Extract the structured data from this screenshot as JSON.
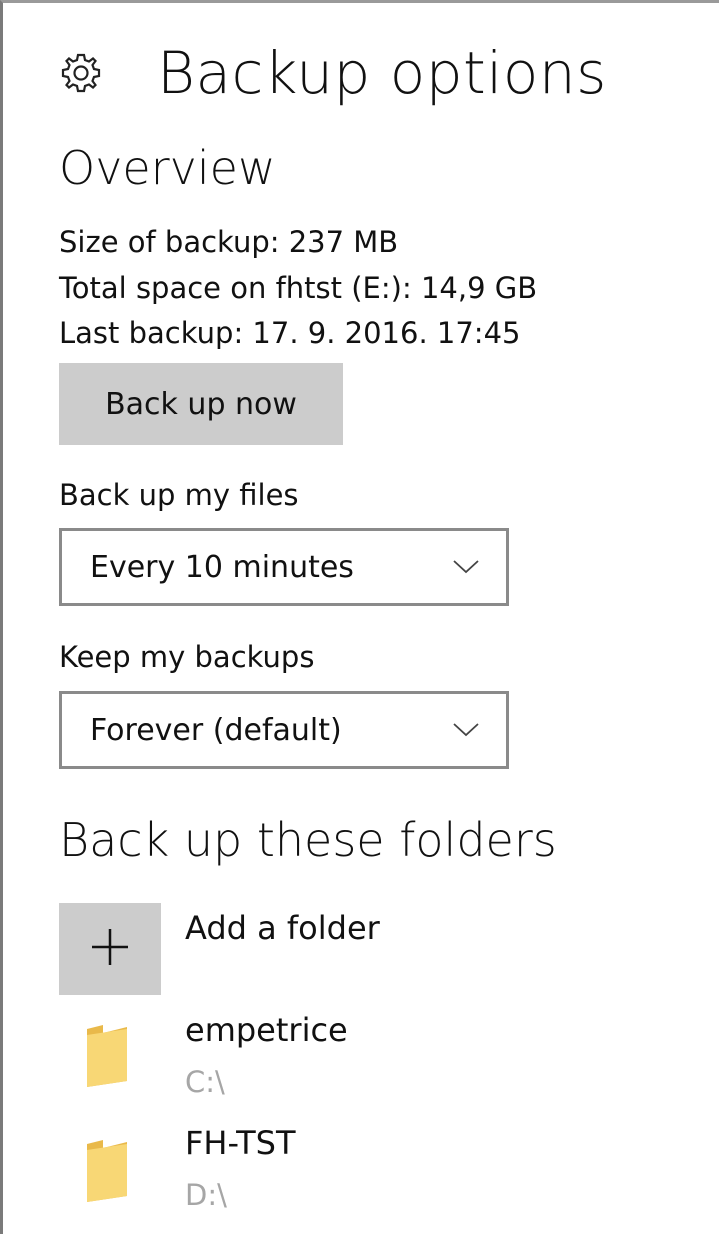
{
  "header": {
    "title": "Backup options",
    "icon": "gear-icon"
  },
  "overview": {
    "title": "Overview",
    "size_of_backup": "Size of backup: 237 MB",
    "total_space": "Total space on fhtst (E:): 14,9 GB",
    "last_backup": "Last backup: 17. 9. 2016. 17:45",
    "back_up_now_label": "Back up now"
  },
  "backup_frequency": {
    "label": "Back up my files",
    "selected": "Every 10 minutes"
  },
  "retention": {
    "label": "Keep my backups",
    "selected": "Forever (default)"
  },
  "folders": {
    "title": "Back up these folders",
    "add_label": "Add a folder",
    "items": [
      {
        "name": "empetrice",
        "path": "C:\\"
      },
      {
        "name": "FH-TST",
        "path": "D:\\"
      }
    ]
  },
  "colors": {
    "button_bg": "#cccccc",
    "folder_yellow": "#f8d775",
    "path_gray": "#a6a6a6",
    "border_gray": "#8a8a8a"
  }
}
